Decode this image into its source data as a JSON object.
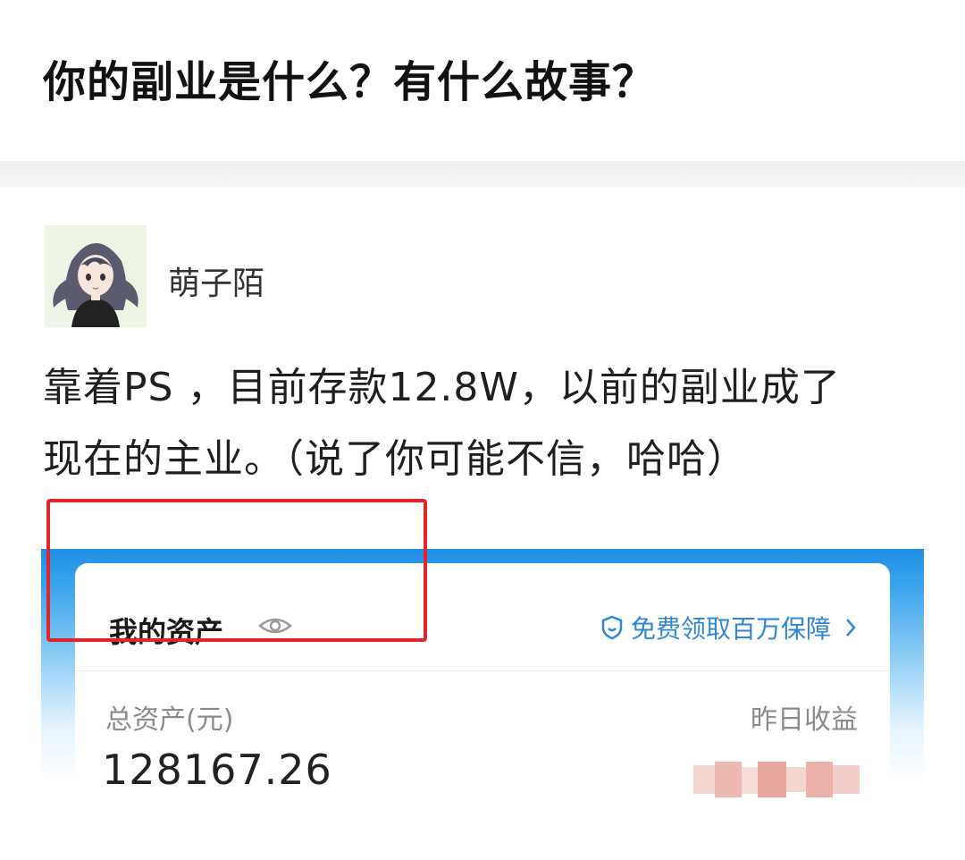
{
  "question": {
    "title": "你的副业是什么？有什么故事？"
  },
  "answer": {
    "author_name": "萌子陌",
    "text_lines": [
      "靠着PS ，目前存款12.8W，以前的副业成了",
      "现在的主业。（说了你可能不信，哈哈）"
    ]
  },
  "asset_screenshot": {
    "title": "我的资产",
    "promo_link": "免费领取百万保障",
    "total_label": "总资产(元)",
    "total_value": "128167.26",
    "yesterday_label": "昨日收益",
    "header_color": "#1e8fe4",
    "highlight_color": "#e0262b",
    "link_color": "#2f86d6"
  }
}
